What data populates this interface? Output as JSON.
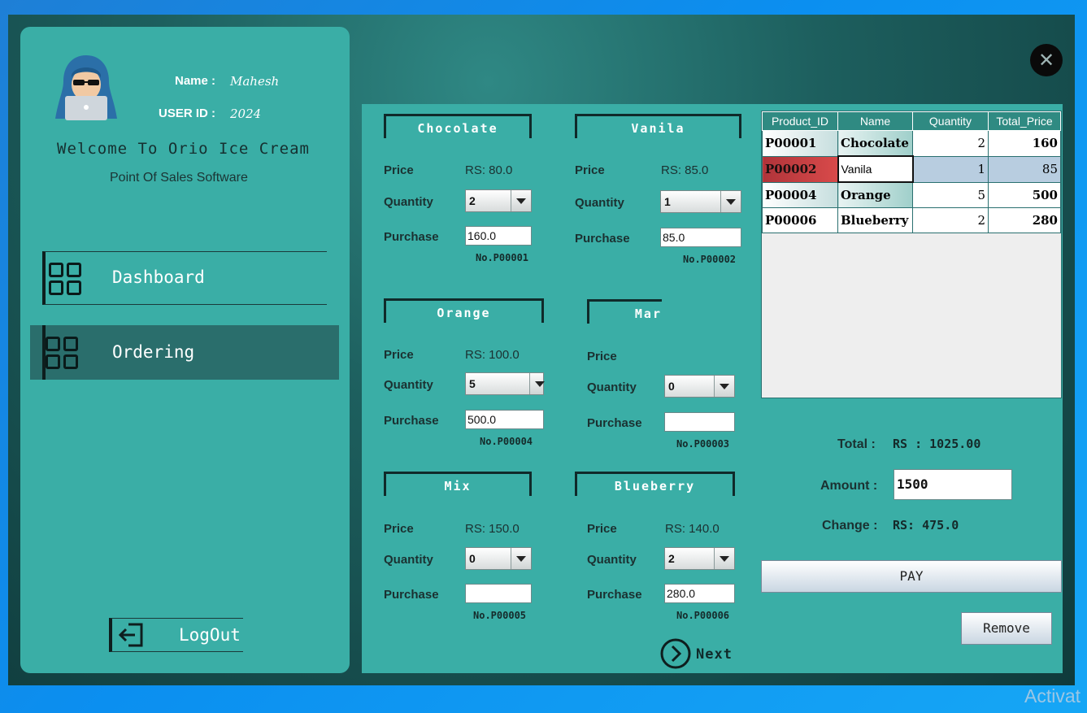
{
  "profile": {
    "name_label": "Name :",
    "name_value": "Mahesh",
    "userid_label": "USER ID :",
    "userid_value": "2024",
    "welcome": "Welcome To Orio Ice Cream",
    "subtitle": "Point Of Sales Software"
  },
  "nav": {
    "dashboard": "Dashboard",
    "ordering": "Ordering",
    "logout": "LogOut"
  },
  "products": {
    "price_label": "Price",
    "quantity_label": "Quantity",
    "purchase_label": "Purchase",
    "chocolate": {
      "name": "Chocolate",
      "price": "RS: 80.0",
      "qty": "2",
      "purchase": "160.0",
      "pno": "No.P00001"
    },
    "vanila": {
      "name": "Vanila",
      "price": "RS: 85.0",
      "qty": "1",
      "purchase": "85.0",
      "pno": "No.P00002"
    },
    "orange": {
      "name": "Orange",
      "price": "RS: 100.0",
      "qty": "5",
      "purchase": "500.0",
      "pno": "No.P00004"
    },
    "mango": {
      "name": "Mar",
      "price": "",
      "qty": "0",
      "purchase": "",
      "pno": "No.P00003"
    },
    "mix": {
      "name": "Mix",
      "price": "RS: 150.0",
      "qty": "0",
      "purchase": "",
      "pno": "No.P00005"
    },
    "blueberry": {
      "name": "Blueberry",
      "price": "RS: 140.0",
      "qty": "2",
      "purchase": "280.0",
      "pno": "No.P00006"
    }
  },
  "next_label": "Next",
  "order_table": {
    "headers": [
      "Product_ID",
      "Name",
      "Quantity",
      "Total_Price"
    ],
    "rows": [
      [
        "P00001",
        "Chocolate",
        "2",
        "160"
      ],
      [
        "P00002",
        "Vanila",
        "1",
        "85"
      ],
      [
        "P00004",
        "Orange",
        "5",
        "500"
      ],
      [
        "P00006",
        "Blueberry",
        "2",
        "280"
      ]
    ]
  },
  "summary": {
    "total_label": "Total :",
    "total_value": "RS : 1025.00",
    "amount_label": "Amount :",
    "amount_value": "1500",
    "change_label": "Change :",
    "change_value": "RS: 475.0"
  },
  "buttons": {
    "pay": "PAY",
    "remove": "Remove"
  },
  "watermark": "Activat",
  "colors": {
    "panel": "#3aaea6",
    "selected_id_cell": "#b0343a",
    "selected_row": "#b8cde0"
  }
}
